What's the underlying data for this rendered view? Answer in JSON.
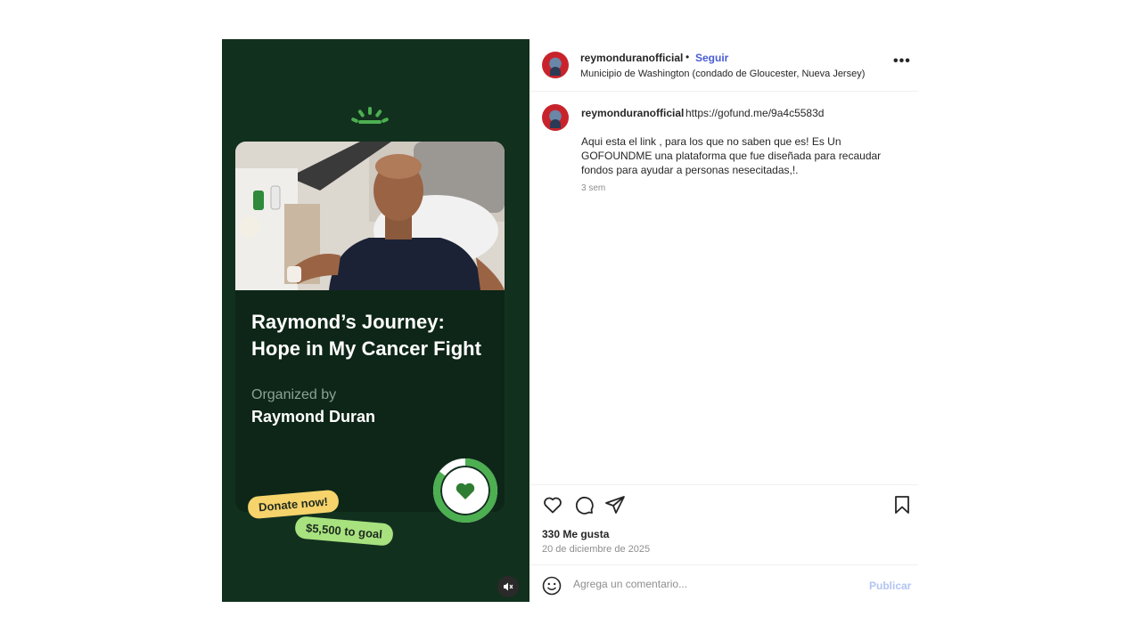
{
  "post": {
    "username": "reymonduranofficial",
    "separator": "•",
    "follow_label": "Seguir",
    "location": "Municipio de Washington (condado de Gloucester, Nueva Jersey)",
    "more_label": "•••"
  },
  "caption": {
    "username": "reymonduranofficial",
    "link": "https://gofund.me/9a4c5583d",
    "text": "Aqui esta el link , para los que no saben que es! Es Un\nGOFOUNDME una plataforma que fue diseñada para recaudar\nfondos para ayudar a personas nesecitadas,!.",
    "time": "3 sem"
  },
  "media": {
    "title": "Raymond’s Journey: Hope in My Cancer Fight",
    "organized_label": "Organized by",
    "organizer": "Raymond Duran",
    "donate_label": "Donate now!",
    "goal_label": "$5,500 to goal",
    "progress_fraction": 0.85,
    "colors": {
      "background": "#12301e",
      "card": "#0d2617",
      "accent_green": "#4caf50",
      "donate_pill": "#f6d36b",
      "goal_pill": "#a7e27f"
    }
  },
  "actions": {
    "likes": "330 Me gusta",
    "date": "20 de diciembre de 2025",
    "comment_placeholder": "Agrega un comentario...",
    "post_label": "Publicar",
    "icons": [
      "heart-icon",
      "comment-icon",
      "share-icon",
      "bookmark-icon",
      "emoji-icon",
      "mute-icon"
    ]
  }
}
